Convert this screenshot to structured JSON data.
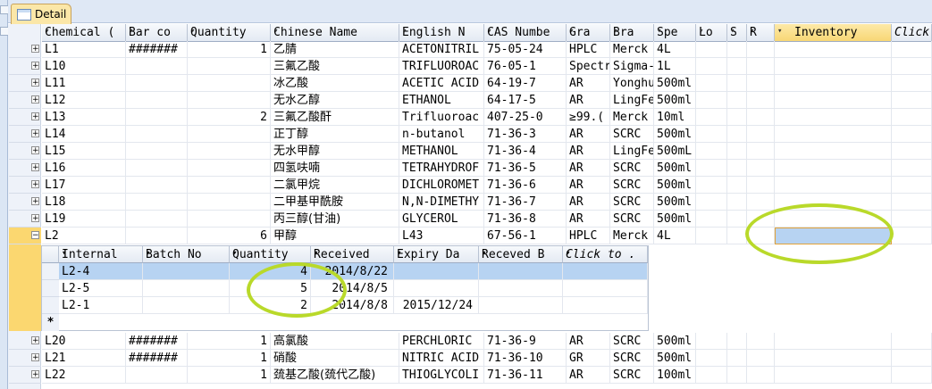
{
  "tab": {
    "label": "Detail"
  },
  "columns": [
    {
      "label": "Chemical (",
      "arrow": "▾"
    },
    {
      "label": "Bar co",
      "arrow": "▾"
    },
    {
      "label": "Quantity",
      "arrow": "▾"
    },
    {
      "label": "Chinese Name",
      "arrow": "▾"
    },
    {
      "label": "English N",
      "arrow": "▾"
    },
    {
      "label": "CAS Numbe",
      "arrow": "▾"
    },
    {
      "label": "Gra",
      "arrow": "▾"
    },
    {
      "label": "Bra",
      "arrow": "▾"
    },
    {
      "label": "Spe",
      "arrow": "▾"
    },
    {
      "label": "Lo",
      "arrow": "▾"
    },
    {
      "label": "S",
      "arrow": "▾"
    },
    {
      "label": "R",
      "arrow": "▾"
    },
    {
      "label": "Inventory",
      "arrow": "▾"
    },
    {
      "label": "Click",
      "arrow": ""
    }
  ],
  "rows": [
    {
      "exp": "+",
      "cells": [
        "L1",
        "#######",
        "1",
        "乙腈",
        "ACETONITRIL",
        "75-05-24",
        "HPLC",
        "Merck",
        "4L",
        "",
        "",
        "",
        "",
        ""
      ]
    },
    {
      "exp": "+",
      "cells": [
        "L10",
        "",
        "",
        "三氟乙酸",
        "TRIFLUOROAC",
        "76-05-1",
        "Spectr",
        "Sigma-",
        "1L",
        "",
        "",
        "",
        "",
        ""
      ]
    },
    {
      "exp": "+",
      "cells": [
        "L11",
        "",
        "",
        "冰乙酸",
        "ACETIC ACID",
        "64-19-7",
        "AR",
        "Yonghu",
        "500ml",
        "",
        "",
        "",
        "",
        ""
      ]
    },
    {
      "exp": "+",
      "cells": [
        "L12",
        "",
        "",
        "无水乙醇",
        "ETHANOL",
        "64-17-5",
        "AR",
        "LingFe",
        "500ml",
        "",
        "",
        "",
        "",
        ""
      ]
    },
    {
      "exp": "+",
      "cells": [
        "L13",
        "",
        "2",
        "三氟乙酸酐",
        "Trifluoroac",
        "407-25-0",
        "≥99.(",
        "Merck",
        "10ml",
        "",
        "",
        "",
        "",
        ""
      ]
    },
    {
      "exp": "+",
      "cells": [
        "L14",
        "",
        "",
        "正丁醇",
        "n-butanol",
        "71-36-3",
        "AR",
        "SCRC",
        "500ml",
        "",
        "",
        "",
        "",
        ""
      ]
    },
    {
      "exp": "+",
      "cells": [
        "L15",
        "",
        "",
        "无水甲醇",
        "METHANOL",
        "71-36-4",
        "AR",
        "LingFe",
        "500mL",
        "",
        "",
        "",
        "",
        ""
      ]
    },
    {
      "exp": "+",
      "cells": [
        "L16",
        "",
        "",
        "四氢呋喃",
        "TETRAHYDROF",
        "71-36-5",
        "AR",
        "SCRC",
        "500ml",
        "",
        "",
        "",
        "",
        ""
      ]
    },
    {
      "exp": "+",
      "cells": [
        "L17",
        "",
        "",
        "二氯甲烷",
        "DICHLOROMET",
        "71-36-6",
        "AR",
        "SCRC",
        "500ml",
        "",
        "",
        "",
        "",
        ""
      ]
    },
    {
      "exp": "+",
      "cells": [
        "L18",
        "",
        "",
        "二甲基甲酰胺",
        "N,N-DIMETHY",
        "71-36-7",
        "AR",
        "SCRC",
        "500ml",
        "",
        "",
        "",
        "",
        ""
      ]
    },
    {
      "exp": "+",
      "cells": [
        "L19",
        "",
        "",
        "丙三醇(甘油)",
        "GLYCEROL",
        "71-36-8",
        "AR",
        "SCRC",
        "500ml",
        "",
        "",
        "",
        "",
        ""
      ]
    },
    {
      "exp": "−",
      "cells": [
        "L2",
        "",
        "6",
        "甲醇",
        "L43",
        "67-56-1",
        "HPLC",
        "Merck",
        "4L",
        "",
        "",
        "",
        "",
        ""
      ]
    }
  ],
  "rows_after": [
    {
      "exp": "+",
      "cells": [
        "L20",
        "#######",
        "1",
        "高氯酸",
        "PERCHLORIC",
        "71-36-9",
        "AR",
        "SCRC",
        "500ml",
        "",
        "",
        "",
        "",
        ""
      ]
    },
    {
      "exp": "+",
      "cells": [
        "L21",
        "#######",
        "1",
        "硝酸",
        "NITRIC ACID",
        "71-36-10",
        "GR",
        "SCRC",
        "500ml",
        "",
        "",
        "",
        "",
        ""
      ]
    },
    {
      "exp": "+",
      "cells": [
        "L22",
        "",
        "1",
        "巯基乙酸(巯代乙酸)",
        "THIOGLYCOLI",
        "71-36-11",
        "AR",
        "SCRC",
        "100ml",
        "",
        "",
        "",
        "",
        ""
      ]
    }
  ],
  "subtable": {
    "columns": [
      {
        "label": "Internal",
        "arrow": "▾"
      },
      {
        "label": "Batch No",
        "arrow": "▾"
      },
      {
        "label": "Quantity",
        "arrow": "▾"
      },
      {
        "label": "Received",
        "arrow": "▾"
      },
      {
        "label": "Expiry Da",
        "arrow": "▾"
      },
      {
        "label": "Receved B",
        "arrow": "▾"
      },
      {
        "label": "Click to .",
        "arrow": "▾"
      }
    ],
    "rows": [
      {
        "cells": [
          "L2-4",
          "",
          "4",
          "2014/8/22",
          "",
          "",
          ""
        ]
      },
      {
        "cells": [
          "L2-5",
          "",
          "5",
          "2014/8/5",
          "",
          "",
          ""
        ]
      },
      {
        "cells": [
          "L2-1",
          "",
          "2",
          "2014/8/8",
          "2015/12/24",
          "",
          ""
        ]
      }
    ],
    "new_row_marker": "*"
  },
  "colors": {
    "highlight_ring": "#b9d92a",
    "selected_cell": "#b7d3f2",
    "tab_bg": "#fbe7a8"
  }
}
